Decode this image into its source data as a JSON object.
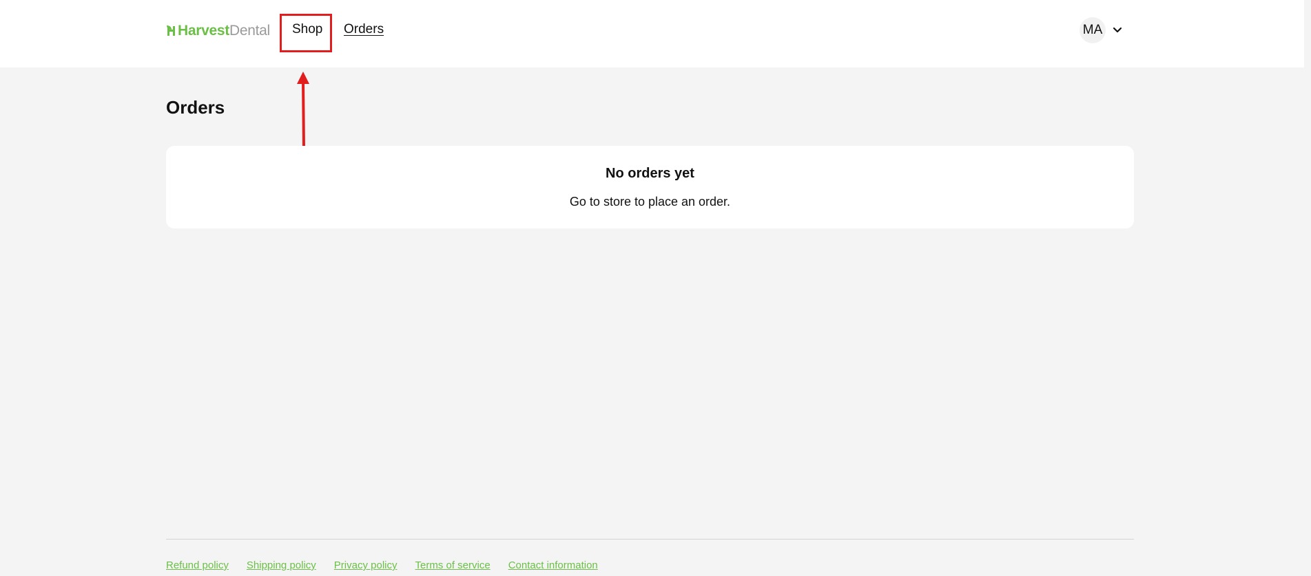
{
  "header": {
    "logo": {
      "part_a": "Harvest",
      "part_b": "Dental",
      "icon": "leaf-h-logo-icon",
      "brand_color": "#6bbf47"
    },
    "nav": {
      "shop_label": "Shop",
      "orders_label": "Orders"
    },
    "account": {
      "initials": "MA",
      "icon": "chevron-down-icon"
    }
  },
  "main": {
    "title": "Orders",
    "empty_state": {
      "heading": "No orders yet",
      "message": "Go to store to place an order."
    }
  },
  "footer": {
    "links": [
      "Refund policy",
      "Shipping policy",
      "Privacy policy",
      "Terms of service",
      "Contact information"
    ]
  },
  "annotation": {
    "highlight_color": "#e01e1e",
    "target": "Shop"
  }
}
